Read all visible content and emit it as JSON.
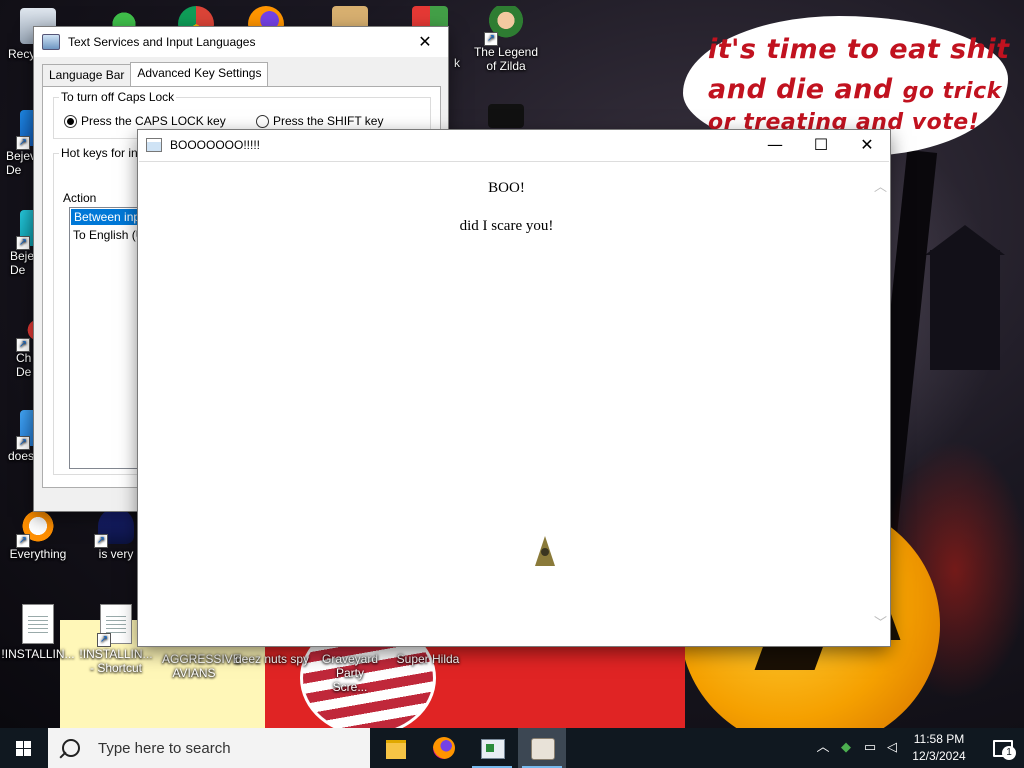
{
  "desktop": {
    "wallpaper_text": {
      "line1": "it's time to eat shit",
      "line2_main": "and die and",
      "line2_small": "go trick",
      "line3": "or treating and vote!"
    },
    "icons": [
      {
        "label": "Recy"
      },
      {
        "label": "Bejev De"
      },
      {
        "label": "Beje De"
      },
      {
        "label": "Ch De"
      },
      {
        "label": "does"
      },
      {
        "label": "Everything"
      },
      {
        "label": "is very"
      },
      {
        "label": "!INSTALLIN..."
      },
      {
        "label": "!INSTALLIN... - Shortcut"
      },
      {
        "label": "AGGRESSIVE AVIANS"
      },
      {
        "label": "deez nuts spy"
      },
      {
        "label": "Graveyard Party Scre..."
      },
      {
        "label": "Super Hilda"
      },
      {
        "label": "The Legend of Zilda"
      },
      {
        "label": "k"
      }
    ]
  },
  "text_services_window": {
    "title": "Text Services and Input Languages",
    "tabs": [
      "Language Bar",
      "Advanced Key Settings"
    ],
    "active_tab": "Advanced Key Settings",
    "caps_group": {
      "legend": "To turn off Caps Lock",
      "option1": "Press the CAPS LOCK key",
      "option2": "Press the SHIFT key",
      "selected": "Press the CAPS LOCK key"
    },
    "hotkeys_group": {
      "legend": "Hot keys for inp",
      "column_header": "Action",
      "rows": [
        "Between input",
        "To English (Ur"
      ]
    }
  },
  "boo_window": {
    "title": "BOOOOOOO!!!!!",
    "heading": "BOO!",
    "message": "did I scare you!"
  },
  "taskbar": {
    "search_placeholder": "Type here to search",
    "clock_time": "11:58 PM",
    "clock_date": "12/3/2024",
    "notification_count": "1",
    "accent_color": "#76b9ed"
  }
}
